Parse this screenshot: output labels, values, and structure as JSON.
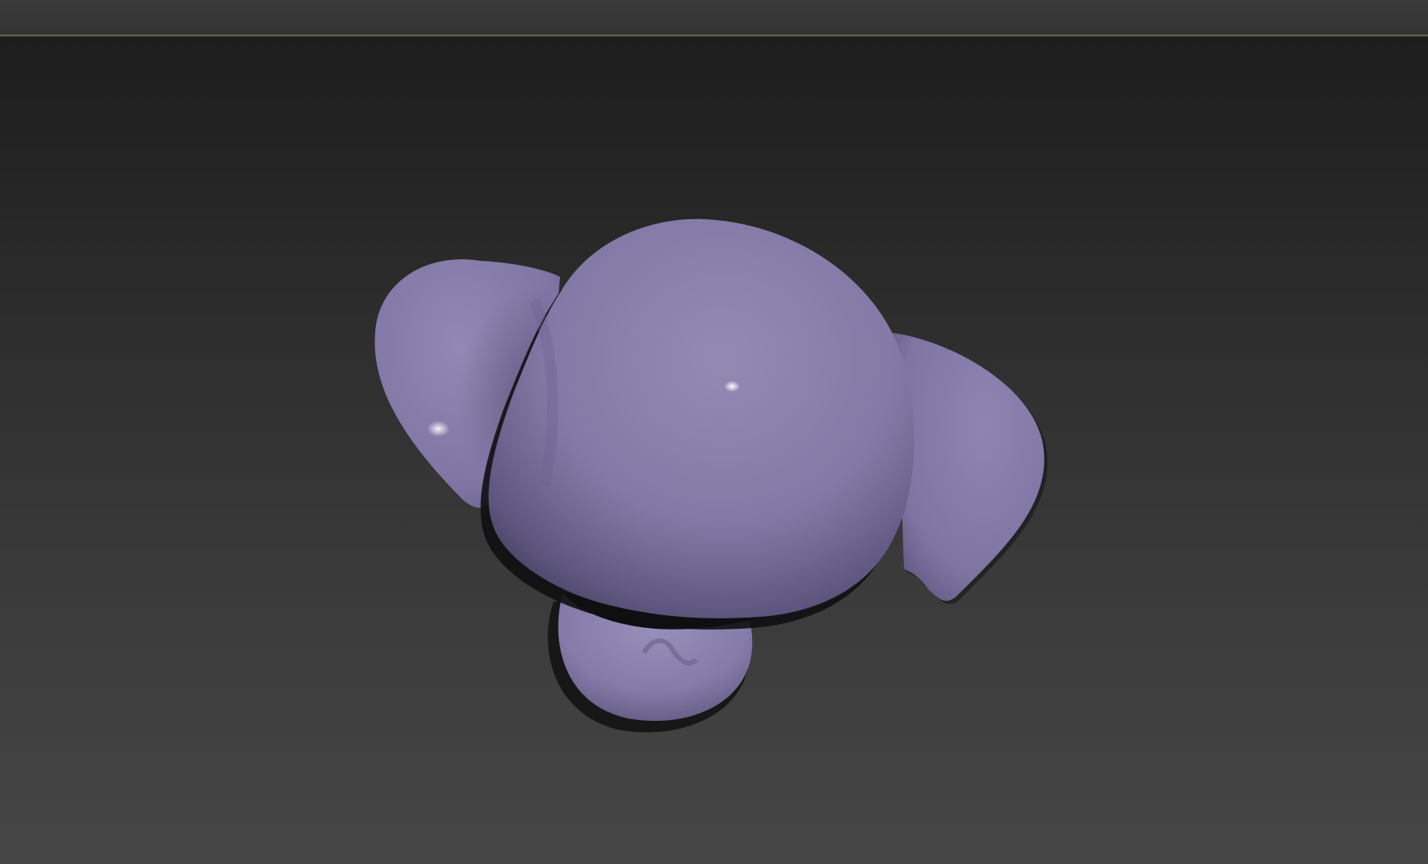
{
  "window": {
    "title": ""
  },
  "viewport": {
    "background_top": "#1d1d1d",
    "background_bottom": "#464646",
    "model_color": "#8a80ab",
    "model_shadow_color": "#5a5478"
  },
  "model": {
    "icon": "elephant-head-mesh-icon"
  }
}
